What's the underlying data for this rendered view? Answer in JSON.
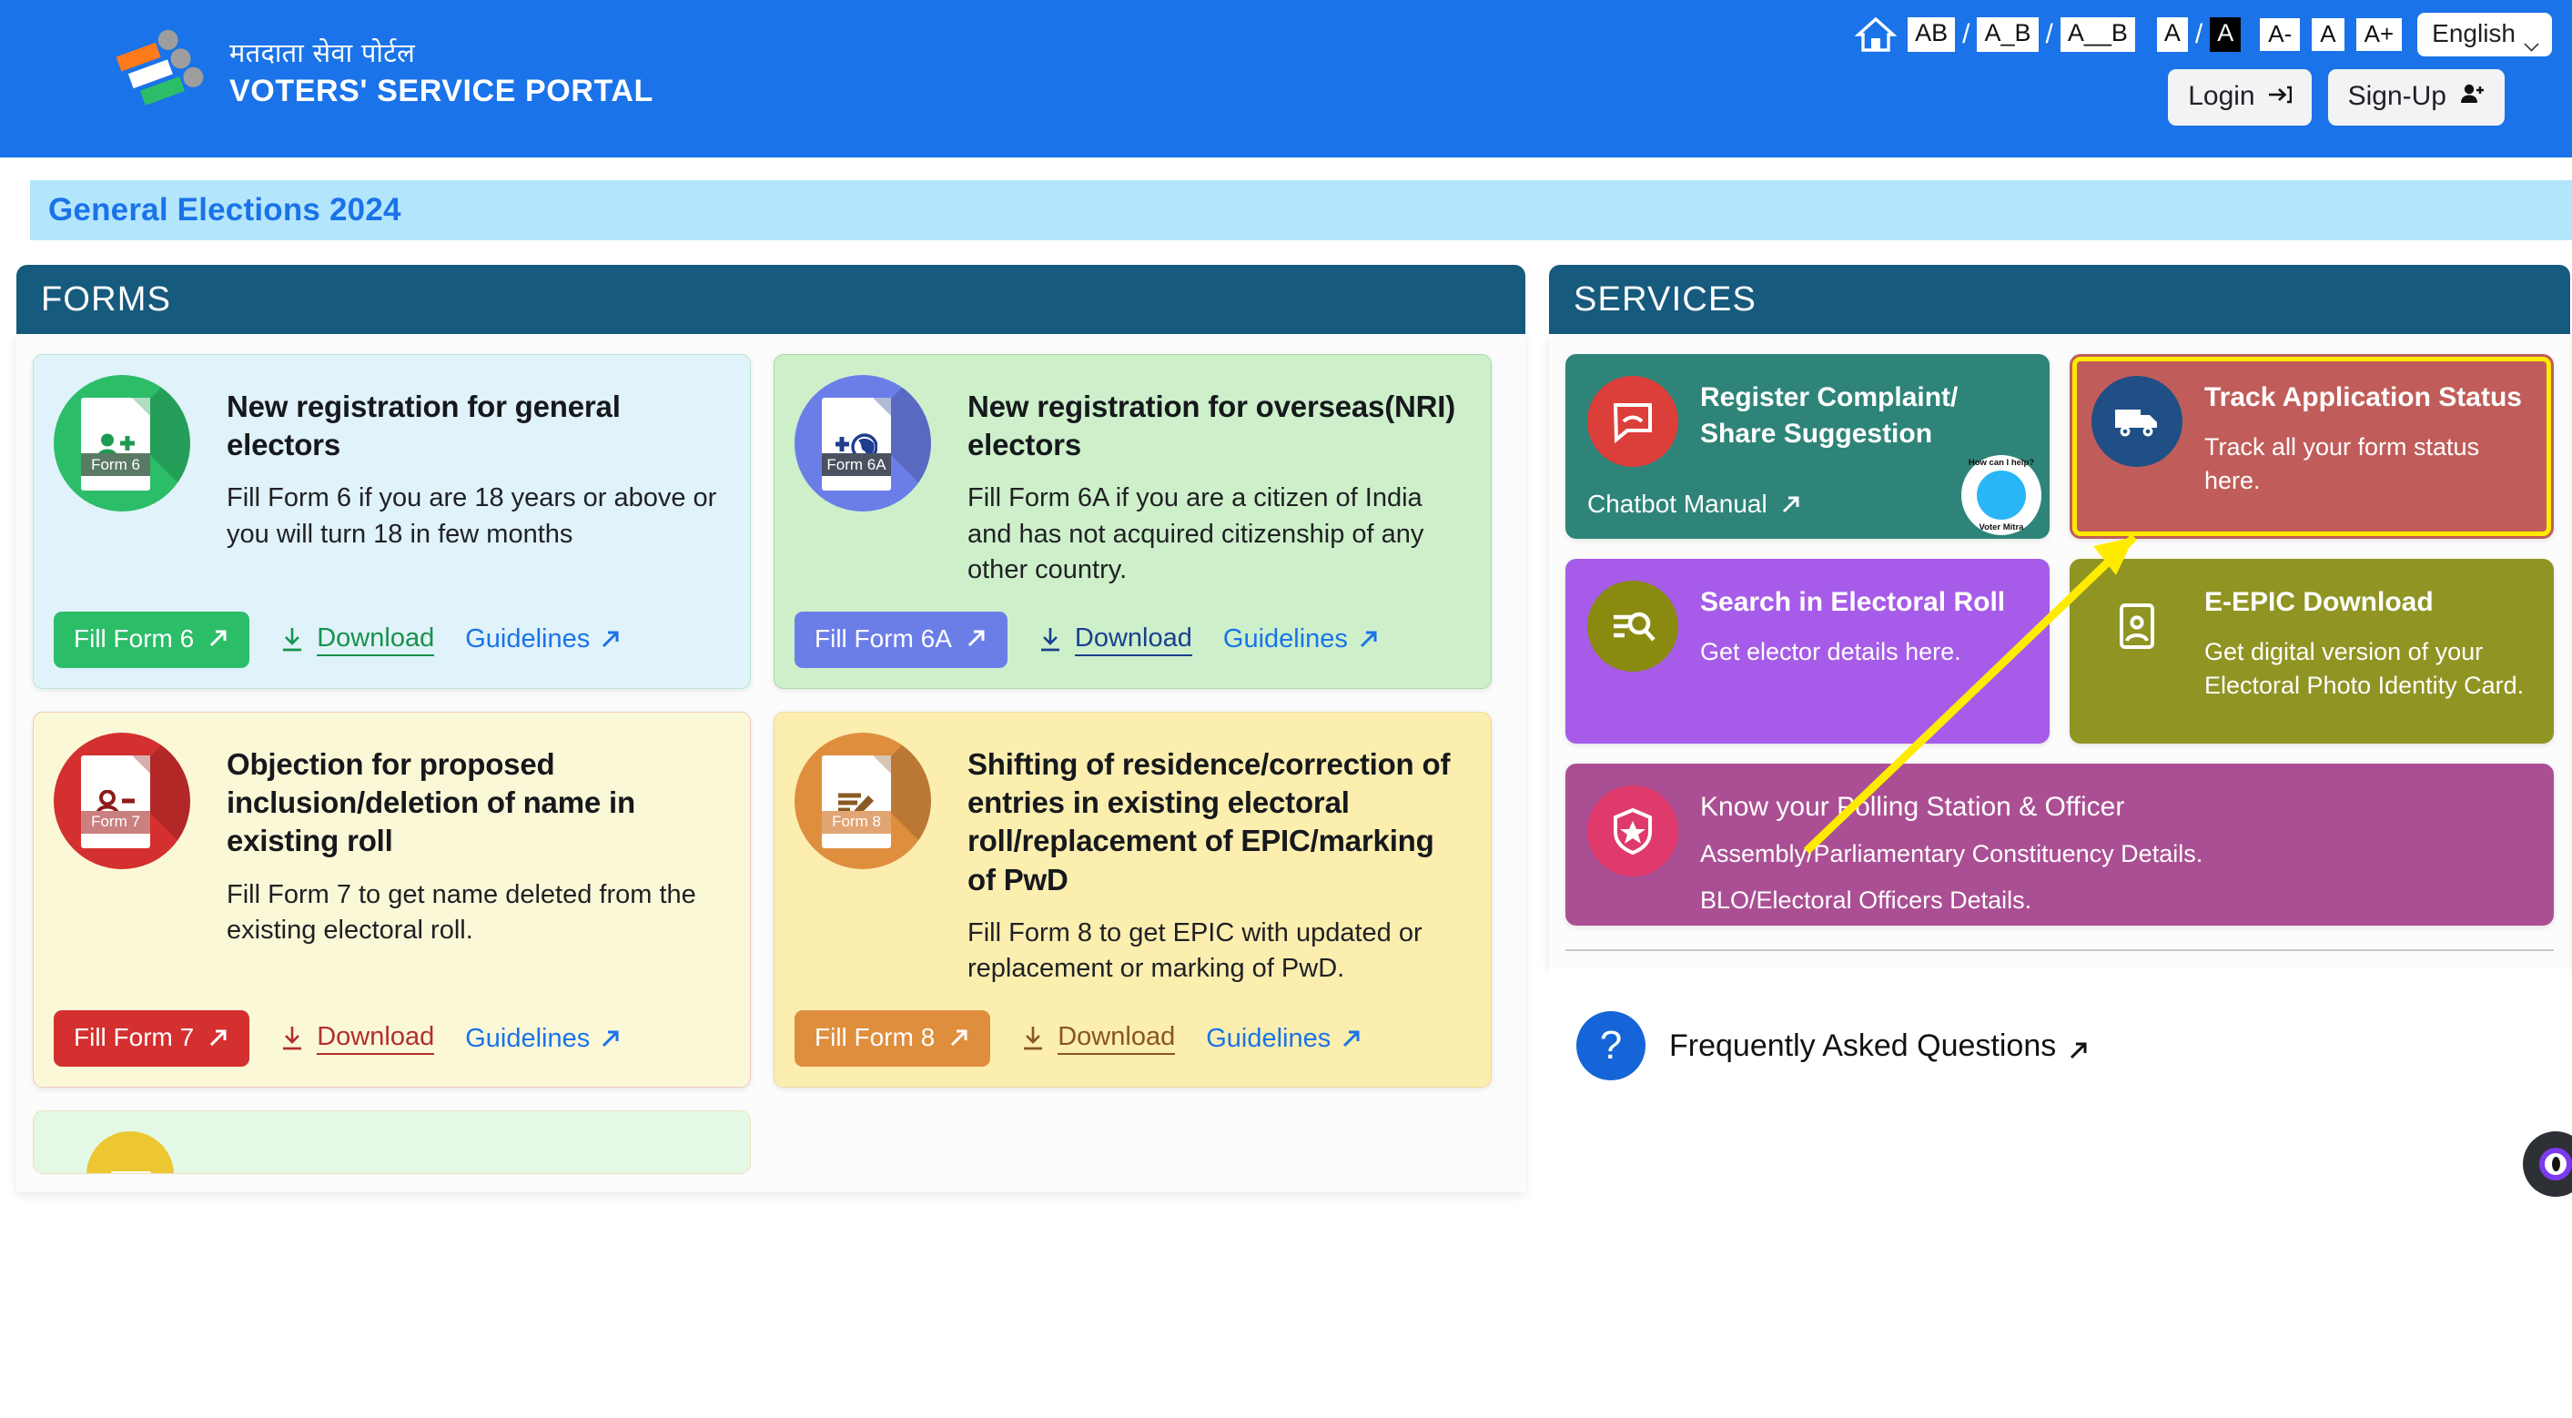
{
  "theme": {
    "header_blue": "#1a73e8",
    "banner_blue": "#b3e5fc",
    "panel_header": "#165a7d",
    "link_blue": "#1a73e8",
    "highlight_yellow": "#ffeb00"
  },
  "header": {
    "brand_hindi": "मतदाता सेवा पोर्टल",
    "brand_english": "VOTERS' SERVICE PORTAL",
    "logo_icon": "eci-logo-icon",
    "home_icon": "home-icon",
    "contrast_options": [
      {
        "label": "AB",
        "name": "contrast-ab",
        "inverted": false
      },
      {
        "label": "A_B",
        "name": "contrast-a-b",
        "inverted": false
      },
      {
        "label": "A__B",
        "name": "contrast-a--b",
        "inverted": false
      },
      {
        "label": "A",
        "name": "contrast-normal",
        "inverted": false
      },
      {
        "label": "A",
        "name": "contrast-inverted",
        "inverted": true
      }
    ],
    "separator": "/",
    "font_size_controls": [
      {
        "label": "A-",
        "name": "font-decrease"
      },
      {
        "label": "A",
        "name": "font-reset"
      },
      {
        "label": "A+",
        "name": "font-increase"
      }
    ],
    "language": "English",
    "login_label": "Login",
    "login_icon": "login-arrow-icon",
    "signup_label": "Sign-Up",
    "signup_icon": "user-plus-icon"
  },
  "banner": {
    "title": "General Elections 2024"
  },
  "forms_panel": {
    "heading": "FORMS",
    "cards": [
      {
        "form_id": "Form 6",
        "title": "New registration for general electors",
        "description": "Fill Form 6 if you are 18 years or above or you will turn 18 in few months",
        "fill_label": "Fill Form 6",
        "download_label": "Download",
        "guidelines_label": "Guidelines",
        "card_bg": "#e0f2fa",
        "card_border": "#b8e6d5",
        "accent": "#2cbd69",
        "accent_dark": "#1e9a52",
        "band": "#5a7a64",
        "download_color": "#17924b",
        "icon_glyph": "person-add-icon"
      },
      {
        "form_id": "Form 6A",
        "title": "New registration for overseas(NRI) electors",
        "description": "Fill Form 6A if you are a citizen of India and has not acquired citizenship of any other country.",
        "fill_label": "Fill Form 6A",
        "download_label": "Download",
        "guidelines_label": "Guidelines",
        "card_bg": "#cdf0cb",
        "card_border": "#a9dca6",
        "accent": "#6b7ee8",
        "accent_dark": "#1f3d8f",
        "band": "#4a5160",
        "download_color": "#1a3f8f",
        "icon_glyph": "globe-plus-icon"
      },
      {
        "form_id": "Form 7",
        "title": "Objection for proposed inclusion/deletion of name in existing roll",
        "description": "Fill Form 7 to get name deleted from the existing electoral roll.",
        "fill_label": "Fill Form 7",
        "download_label": "Download",
        "guidelines_label": "Guidelines",
        "card_bg": "#fbf8d8",
        "card_border": "#f0c9c0",
        "accent": "#d3302f",
        "accent_dark": "#8e1b1b",
        "band": "#c9807e",
        "download_color": "#b22f2c",
        "icon_glyph": "person-minus-icon"
      },
      {
        "form_id": "Form 8",
        "title": "Shifting of residence/correction of entries in existing electoral roll/replacement of EPIC/marking of PwD",
        "description": "Fill Form 8 to get EPIC with updated or replacement or marking of PwD.",
        "fill_label": "Fill Form 8",
        "download_label": "Download",
        "guidelines_label": "Guidelines",
        "card_bg": "#fbeeaf",
        "card_border": "#f0d9a0",
        "accent": "#df8e3e",
        "accent_dark": "#8a5a24",
        "band": "#e0a572",
        "download_color": "#8a5520",
        "icon_glyph": "edit-lines-icon"
      }
    ]
  },
  "services_panel": {
    "heading": "SERVICES",
    "cards": [
      {
        "title": "Register Complaint/ Share Suggestion",
        "description": "",
        "footer_label": "Chatbot Manual",
        "card_bg": "#2e8478",
        "icon_bg": "#dc3e3a",
        "icon_glyph": "chat-bubble-icon",
        "size": "half",
        "highlighted": false,
        "badge": {
          "top_text": "How can I help?",
          "bottom_text": "Voter Mitra",
          "name": "voter-mitra-badge"
        }
      },
      {
        "title": "Track Application Status",
        "description": "Track all your form status here.",
        "footer_label": "",
        "card_bg": "#c05d5a",
        "icon_bg": "#1f4f84",
        "icon_glyph": "truck-icon",
        "size": "half",
        "highlighted": true
      },
      {
        "title": "Search in Electoral Roll",
        "description": "Get elector details here.",
        "footer_label": "",
        "card_bg": "#a65ce8",
        "icon_bg": "#8a8a10",
        "icon_glyph": "list-search-icon",
        "size": "half",
        "highlighted": false
      },
      {
        "title": "E-EPIC Download",
        "description": "Get digital version of your Electoral Photo Identity Card.",
        "footer_label": "",
        "card_bg": "#8f9423",
        "icon_bg": "#22a css",
        "icon_glyph": "id-card-icon",
        "size": "half",
        "highlighted": false
      },
      {
        "title": "Know your Polling Station & Officer",
        "description_lines": [
          "Assembly/Parliamentary Constituency Details.",
          "BLO/Electoral Officers Details."
        ],
        "footer_label": "",
        "card_bg": "#ab4f94",
        "icon_bg": "#e03a6d",
        "icon_glyph": "shield-star-icon",
        "size": "full",
        "highlighted": false
      }
    ],
    "faq": {
      "label": "Frequently Asked Questions",
      "icon": "question-mark-icon"
    }
  },
  "annotation": {
    "type": "arrow",
    "color": "#ffeb00",
    "description": "yellow arrow pointing to Track Application Status card"
  },
  "chat_widget": {
    "name": "chat-fab",
    "icon": "chat-assistant-icon"
  }
}
